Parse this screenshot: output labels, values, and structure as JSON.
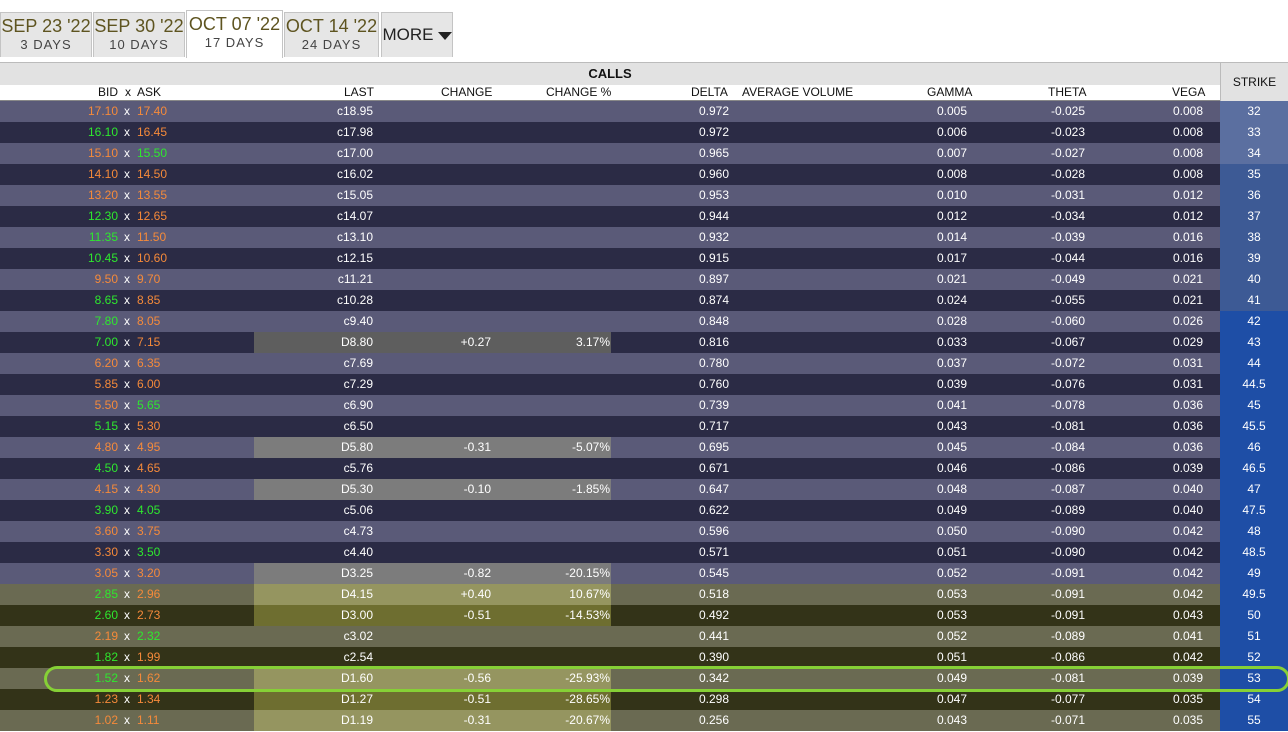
{
  "tabs": [
    {
      "date": "SEP 23 '22",
      "days": "3 DAYS"
    },
    {
      "date": "SEP 30 '22",
      "days": "10 DAYS"
    },
    {
      "date": "OCT 07 '22",
      "days": "17 DAYS"
    },
    {
      "date": "OCT 14 '22",
      "days": "24 DAYS"
    }
  ],
  "more_label": "MORE",
  "header": {
    "calls": "CALLS",
    "strike": "STRIKE",
    "bid": "BID",
    "x": "x",
    "ask": "ASK",
    "last": "LAST",
    "change": "CHANGE",
    "change_pct": "CHANGE %",
    "delta": "DELTA",
    "avg_volume": "AVERAGE VOLUME",
    "gamma": "GAMMA",
    "theta": "THETA",
    "vega": "VEGA"
  },
  "colors": {
    "row_light": "#5a5a78",
    "row_dark": "#2b2b45",
    "row_itm_light": "#6a6a52",
    "row_itm_dark": "#333318",
    "change_bg_light": "#7c7c7c",
    "change_bg_dark": "#5e5e5e",
    "change_bg_itm_light": "#959560",
    "change_bg_itm_dark": "#6e6e30",
    "strike_light": "#5b6fa0",
    "strike_dark": "#3d5a95",
    "strike_blue": "#1e4ea6",
    "bid_up": "#2ee82e",
    "bid_down": "#f58a3a",
    "highlight": "#86d036"
  },
  "rows": [
    {
      "bid": "17.10",
      "bid_color": "orange",
      "ask": "17.40",
      "ask_color": "orange",
      "last": "c18.95",
      "change": "",
      "change_pct": "",
      "delta": "0.972",
      "gamma": "0.005",
      "theta": "-0.025",
      "vega": "0.008",
      "strike": "32"
    },
    {
      "bid": "16.10",
      "bid_color": "green",
      "ask": "16.45",
      "ask_color": "orange",
      "last": "c17.98",
      "change": "",
      "change_pct": "",
      "delta": "0.972",
      "gamma": "0.006",
      "theta": "-0.023",
      "vega": "0.008",
      "strike": "33"
    },
    {
      "bid": "15.10",
      "bid_color": "orange",
      "ask": "15.50",
      "ask_color": "green",
      "last": "c17.00",
      "change": "",
      "change_pct": "",
      "delta": "0.965",
      "gamma": "0.007",
      "theta": "-0.027",
      "vega": "0.008",
      "strike": "34"
    },
    {
      "bid": "14.10",
      "bid_color": "orange",
      "ask": "14.50",
      "ask_color": "orange",
      "last": "c16.02",
      "change": "",
      "change_pct": "",
      "delta": "0.960",
      "gamma": "0.008",
      "theta": "-0.028",
      "vega": "0.008",
      "strike": "35"
    },
    {
      "bid": "13.20",
      "bid_color": "orange",
      "ask": "13.55",
      "ask_color": "orange",
      "last": "c15.05",
      "change": "",
      "change_pct": "",
      "delta": "0.953",
      "gamma": "0.010",
      "theta": "-0.031",
      "vega": "0.012",
      "strike": "36"
    },
    {
      "bid": "12.30",
      "bid_color": "green",
      "ask": "12.65",
      "ask_color": "orange",
      "last": "c14.07",
      "change": "",
      "change_pct": "",
      "delta": "0.944",
      "gamma": "0.012",
      "theta": "-0.034",
      "vega": "0.012",
      "strike": "37"
    },
    {
      "bid": "11.35",
      "bid_color": "green",
      "ask": "11.50",
      "ask_color": "orange",
      "last": "c13.10",
      "change": "",
      "change_pct": "",
      "delta": "0.932",
      "gamma": "0.014",
      "theta": "-0.039",
      "vega": "0.016",
      "strike": "38"
    },
    {
      "bid": "10.45",
      "bid_color": "green",
      "ask": "10.60",
      "ask_color": "orange",
      "last": "c12.15",
      "change": "",
      "change_pct": "",
      "delta": "0.915",
      "gamma": "0.017",
      "theta": "-0.044",
      "vega": "0.016",
      "strike": "39"
    },
    {
      "bid": "9.50",
      "bid_color": "orange",
      "ask": "9.70",
      "ask_color": "orange",
      "last": "c11.21",
      "change": "",
      "change_pct": "",
      "delta": "0.897",
      "gamma": "0.021",
      "theta": "-0.049",
      "vega": "0.021",
      "strike": "40"
    },
    {
      "bid": "8.65",
      "bid_color": "green",
      "ask": "8.85",
      "ask_color": "orange",
      "last": "c10.28",
      "change": "",
      "change_pct": "",
      "delta": "0.874",
      "gamma": "0.024",
      "theta": "-0.055",
      "vega": "0.021",
      "strike": "41"
    },
    {
      "bid": "7.80",
      "bid_color": "green",
      "ask": "8.05",
      "ask_color": "orange",
      "last": "c9.40",
      "change": "",
      "change_pct": "",
      "delta": "0.848",
      "gamma": "0.028",
      "theta": "-0.060",
      "vega": "0.026",
      "strike": "42"
    },
    {
      "bid": "7.00",
      "bid_color": "green",
      "ask": "7.15",
      "ask_color": "orange",
      "last": "D8.80",
      "change": "+0.27",
      "change_pct": "3.17%",
      "delta": "0.816",
      "gamma": "0.033",
      "theta": "-0.067",
      "vega": "0.029",
      "strike": "43"
    },
    {
      "bid": "6.20",
      "bid_color": "orange",
      "ask": "6.35",
      "ask_color": "orange",
      "last": "c7.69",
      "change": "",
      "change_pct": "",
      "delta": "0.780",
      "gamma": "0.037",
      "theta": "-0.072",
      "vega": "0.031",
      "strike": "44"
    },
    {
      "bid": "5.85",
      "bid_color": "orange",
      "ask": "6.00",
      "ask_color": "orange",
      "last": "c7.29",
      "change": "",
      "change_pct": "",
      "delta": "0.760",
      "gamma": "0.039",
      "theta": "-0.076",
      "vega": "0.031",
      "strike": "44.5"
    },
    {
      "bid": "5.50",
      "bid_color": "orange",
      "ask": "5.65",
      "ask_color": "green",
      "last": "c6.90",
      "change": "",
      "change_pct": "",
      "delta": "0.739",
      "gamma": "0.041",
      "theta": "-0.078",
      "vega": "0.036",
      "strike": "45"
    },
    {
      "bid": "5.15",
      "bid_color": "green",
      "ask": "5.30",
      "ask_color": "orange",
      "last": "c6.50",
      "change": "",
      "change_pct": "",
      "delta": "0.717",
      "gamma": "0.043",
      "theta": "-0.081",
      "vega": "0.036",
      "strike": "45.5"
    },
    {
      "bid": "4.80",
      "bid_color": "orange",
      "ask": "4.95",
      "ask_color": "orange",
      "last": "D5.80",
      "change": "-0.31",
      "change_pct": "-5.07%",
      "delta": "0.695",
      "gamma": "0.045",
      "theta": "-0.084",
      "vega": "0.036",
      "strike": "46"
    },
    {
      "bid": "4.50",
      "bid_color": "green",
      "ask": "4.65",
      "ask_color": "orange",
      "last": "c5.76",
      "change": "",
      "change_pct": "",
      "delta": "0.671",
      "gamma": "0.046",
      "theta": "-0.086",
      "vega": "0.039",
      "strike": "46.5"
    },
    {
      "bid": "4.15",
      "bid_color": "orange",
      "ask": "4.30",
      "ask_color": "orange",
      "last": "D5.30",
      "change": "-0.10",
      "change_pct": "-1.85%",
      "delta": "0.647",
      "gamma": "0.048",
      "theta": "-0.087",
      "vega": "0.040",
      "strike": "47"
    },
    {
      "bid": "3.90",
      "bid_color": "green",
      "ask": "4.05",
      "ask_color": "green",
      "last": "c5.06",
      "change": "",
      "change_pct": "",
      "delta": "0.622",
      "gamma": "0.049",
      "theta": "-0.089",
      "vega": "0.040",
      "strike": "47.5"
    },
    {
      "bid": "3.60",
      "bid_color": "orange",
      "ask": "3.75",
      "ask_color": "orange",
      "last": "c4.73",
      "change": "",
      "change_pct": "",
      "delta": "0.596",
      "gamma": "0.050",
      "theta": "-0.090",
      "vega": "0.042",
      "strike": "48"
    },
    {
      "bid": "3.30",
      "bid_color": "orange",
      "ask": "3.50",
      "ask_color": "green",
      "last": "c4.40",
      "change": "",
      "change_pct": "",
      "delta": "0.571",
      "gamma": "0.051",
      "theta": "-0.090",
      "vega": "0.042",
      "strike": "48.5"
    },
    {
      "bid": "3.05",
      "bid_color": "orange",
      "ask": "3.20",
      "ask_color": "orange",
      "last": "D3.25",
      "change": "-0.82",
      "change_pct": "-20.15%",
      "delta": "0.545",
      "gamma": "0.052",
      "theta": "-0.091",
      "vega": "0.042",
      "strike": "49"
    },
    {
      "bid": "2.85",
      "bid_color": "green",
      "ask": "2.96",
      "ask_color": "orange",
      "last": "D4.15",
      "change": "+0.40",
      "change_pct": "10.67%",
      "delta": "0.518",
      "gamma": "0.053",
      "theta": "-0.091",
      "vega": "0.042",
      "strike": "49.5"
    },
    {
      "bid": "2.60",
      "bid_color": "green",
      "ask": "2.73",
      "ask_color": "orange",
      "last": "D3.00",
      "change": "-0.51",
      "change_pct": "-14.53%",
      "delta": "0.492",
      "gamma": "0.053",
      "theta": "-0.091",
      "vega": "0.043",
      "strike": "50"
    },
    {
      "bid": "2.19",
      "bid_color": "orange",
      "ask": "2.32",
      "ask_color": "green",
      "last": "c3.02",
      "change": "",
      "change_pct": "",
      "delta": "0.441",
      "gamma": "0.052",
      "theta": "-0.089",
      "vega": "0.041",
      "strike": "51"
    },
    {
      "bid": "1.82",
      "bid_color": "green",
      "ask": "1.99",
      "ask_color": "orange",
      "last": "c2.54",
      "change": "",
      "change_pct": "",
      "delta": "0.390",
      "gamma": "0.051",
      "theta": "-0.086",
      "vega": "0.042",
      "strike": "52"
    },
    {
      "bid": "1.52",
      "bid_color": "green",
      "ask": "1.62",
      "ask_color": "orange",
      "last": "D1.60",
      "change": "-0.56",
      "change_pct": "-25.93%",
      "delta": "0.342",
      "gamma": "0.049",
      "theta": "-0.081",
      "vega": "0.039",
      "strike": "53"
    },
    {
      "bid": "1.23",
      "bid_color": "orange",
      "ask": "1.34",
      "ask_color": "orange",
      "last": "D1.27",
      "change": "-0.51",
      "change_pct": "-28.65%",
      "delta": "0.298",
      "gamma": "0.047",
      "theta": "-0.077",
      "vega": "0.035",
      "strike": "54"
    },
    {
      "bid": "1.02",
      "bid_color": "orange",
      "ask": "1.11",
      "ask_color": "orange",
      "last": "D1.19",
      "change": "-0.31",
      "change_pct": "-20.67%",
      "delta": "0.256",
      "gamma": "0.043",
      "theta": "-0.071",
      "vega": "0.035",
      "strike": "55"
    }
  ]
}
